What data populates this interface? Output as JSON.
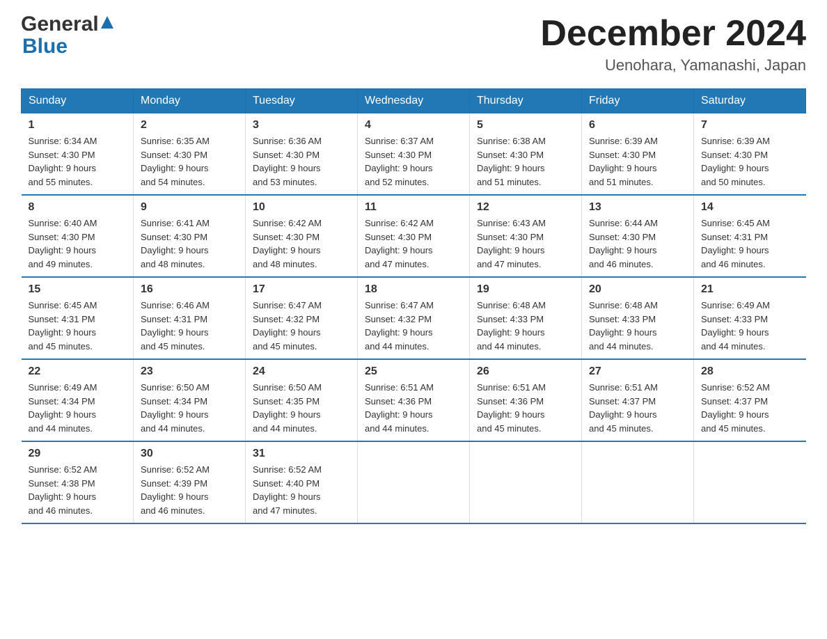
{
  "logo": {
    "general": "General",
    "blue": "Blue",
    "arrow": "▲"
  },
  "title": "December 2024",
  "location": "Uenohara, Yamanashi, Japan",
  "headers": [
    "Sunday",
    "Monday",
    "Tuesday",
    "Wednesday",
    "Thursday",
    "Friday",
    "Saturday"
  ],
  "weeks": [
    [
      {
        "day": "1",
        "sunrise": "6:34 AM",
        "sunset": "4:30 PM",
        "daylight": "9 hours and 55 minutes."
      },
      {
        "day": "2",
        "sunrise": "6:35 AM",
        "sunset": "4:30 PM",
        "daylight": "9 hours and 54 minutes."
      },
      {
        "day": "3",
        "sunrise": "6:36 AM",
        "sunset": "4:30 PM",
        "daylight": "9 hours and 53 minutes."
      },
      {
        "day": "4",
        "sunrise": "6:37 AM",
        "sunset": "4:30 PM",
        "daylight": "9 hours and 52 minutes."
      },
      {
        "day": "5",
        "sunrise": "6:38 AM",
        "sunset": "4:30 PM",
        "daylight": "9 hours and 51 minutes."
      },
      {
        "day": "6",
        "sunrise": "6:39 AM",
        "sunset": "4:30 PM",
        "daylight": "9 hours and 51 minutes."
      },
      {
        "day": "7",
        "sunrise": "6:39 AM",
        "sunset": "4:30 PM",
        "daylight": "9 hours and 50 minutes."
      }
    ],
    [
      {
        "day": "8",
        "sunrise": "6:40 AM",
        "sunset": "4:30 PM",
        "daylight": "9 hours and 49 minutes."
      },
      {
        "day": "9",
        "sunrise": "6:41 AM",
        "sunset": "4:30 PM",
        "daylight": "9 hours and 48 minutes."
      },
      {
        "day": "10",
        "sunrise": "6:42 AM",
        "sunset": "4:30 PM",
        "daylight": "9 hours and 48 minutes."
      },
      {
        "day": "11",
        "sunrise": "6:42 AM",
        "sunset": "4:30 PM",
        "daylight": "9 hours and 47 minutes."
      },
      {
        "day": "12",
        "sunrise": "6:43 AM",
        "sunset": "4:30 PM",
        "daylight": "9 hours and 47 minutes."
      },
      {
        "day": "13",
        "sunrise": "6:44 AM",
        "sunset": "4:30 PM",
        "daylight": "9 hours and 46 minutes."
      },
      {
        "day": "14",
        "sunrise": "6:45 AM",
        "sunset": "4:31 PM",
        "daylight": "9 hours and 46 minutes."
      }
    ],
    [
      {
        "day": "15",
        "sunrise": "6:45 AM",
        "sunset": "4:31 PM",
        "daylight": "9 hours and 45 minutes."
      },
      {
        "day": "16",
        "sunrise": "6:46 AM",
        "sunset": "4:31 PM",
        "daylight": "9 hours and 45 minutes."
      },
      {
        "day": "17",
        "sunrise": "6:47 AM",
        "sunset": "4:32 PM",
        "daylight": "9 hours and 45 minutes."
      },
      {
        "day": "18",
        "sunrise": "6:47 AM",
        "sunset": "4:32 PM",
        "daylight": "9 hours and 44 minutes."
      },
      {
        "day": "19",
        "sunrise": "6:48 AM",
        "sunset": "4:33 PM",
        "daylight": "9 hours and 44 minutes."
      },
      {
        "day": "20",
        "sunrise": "6:48 AM",
        "sunset": "4:33 PM",
        "daylight": "9 hours and 44 minutes."
      },
      {
        "day": "21",
        "sunrise": "6:49 AM",
        "sunset": "4:33 PM",
        "daylight": "9 hours and 44 minutes."
      }
    ],
    [
      {
        "day": "22",
        "sunrise": "6:49 AM",
        "sunset": "4:34 PM",
        "daylight": "9 hours and 44 minutes."
      },
      {
        "day": "23",
        "sunrise": "6:50 AM",
        "sunset": "4:34 PM",
        "daylight": "9 hours and 44 minutes."
      },
      {
        "day": "24",
        "sunrise": "6:50 AM",
        "sunset": "4:35 PM",
        "daylight": "9 hours and 44 minutes."
      },
      {
        "day": "25",
        "sunrise": "6:51 AM",
        "sunset": "4:36 PM",
        "daylight": "9 hours and 44 minutes."
      },
      {
        "day": "26",
        "sunrise": "6:51 AM",
        "sunset": "4:36 PM",
        "daylight": "9 hours and 45 minutes."
      },
      {
        "day": "27",
        "sunrise": "6:51 AM",
        "sunset": "4:37 PM",
        "daylight": "9 hours and 45 minutes."
      },
      {
        "day": "28",
        "sunrise": "6:52 AM",
        "sunset": "4:37 PM",
        "daylight": "9 hours and 45 minutes."
      }
    ],
    [
      {
        "day": "29",
        "sunrise": "6:52 AM",
        "sunset": "4:38 PM",
        "daylight": "9 hours and 46 minutes."
      },
      {
        "day": "30",
        "sunrise": "6:52 AM",
        "sunset": "4:39 PM",
        "daylight": "9 hours and 46 minutes."
      },
      {
        "day": "31",
        "sunrise": "6:52 AM",
        "sunset": "4:40 PM",
        "daylight": "9 hours and 47 minutes."
      },
      null,
      null,
      null,
      null
    ]
  ],
  "labels": {
    "sunrise": "Sunrise:",
    "sunset": "Sunset:",
    "daylight": "Daylight:"
  }
}
